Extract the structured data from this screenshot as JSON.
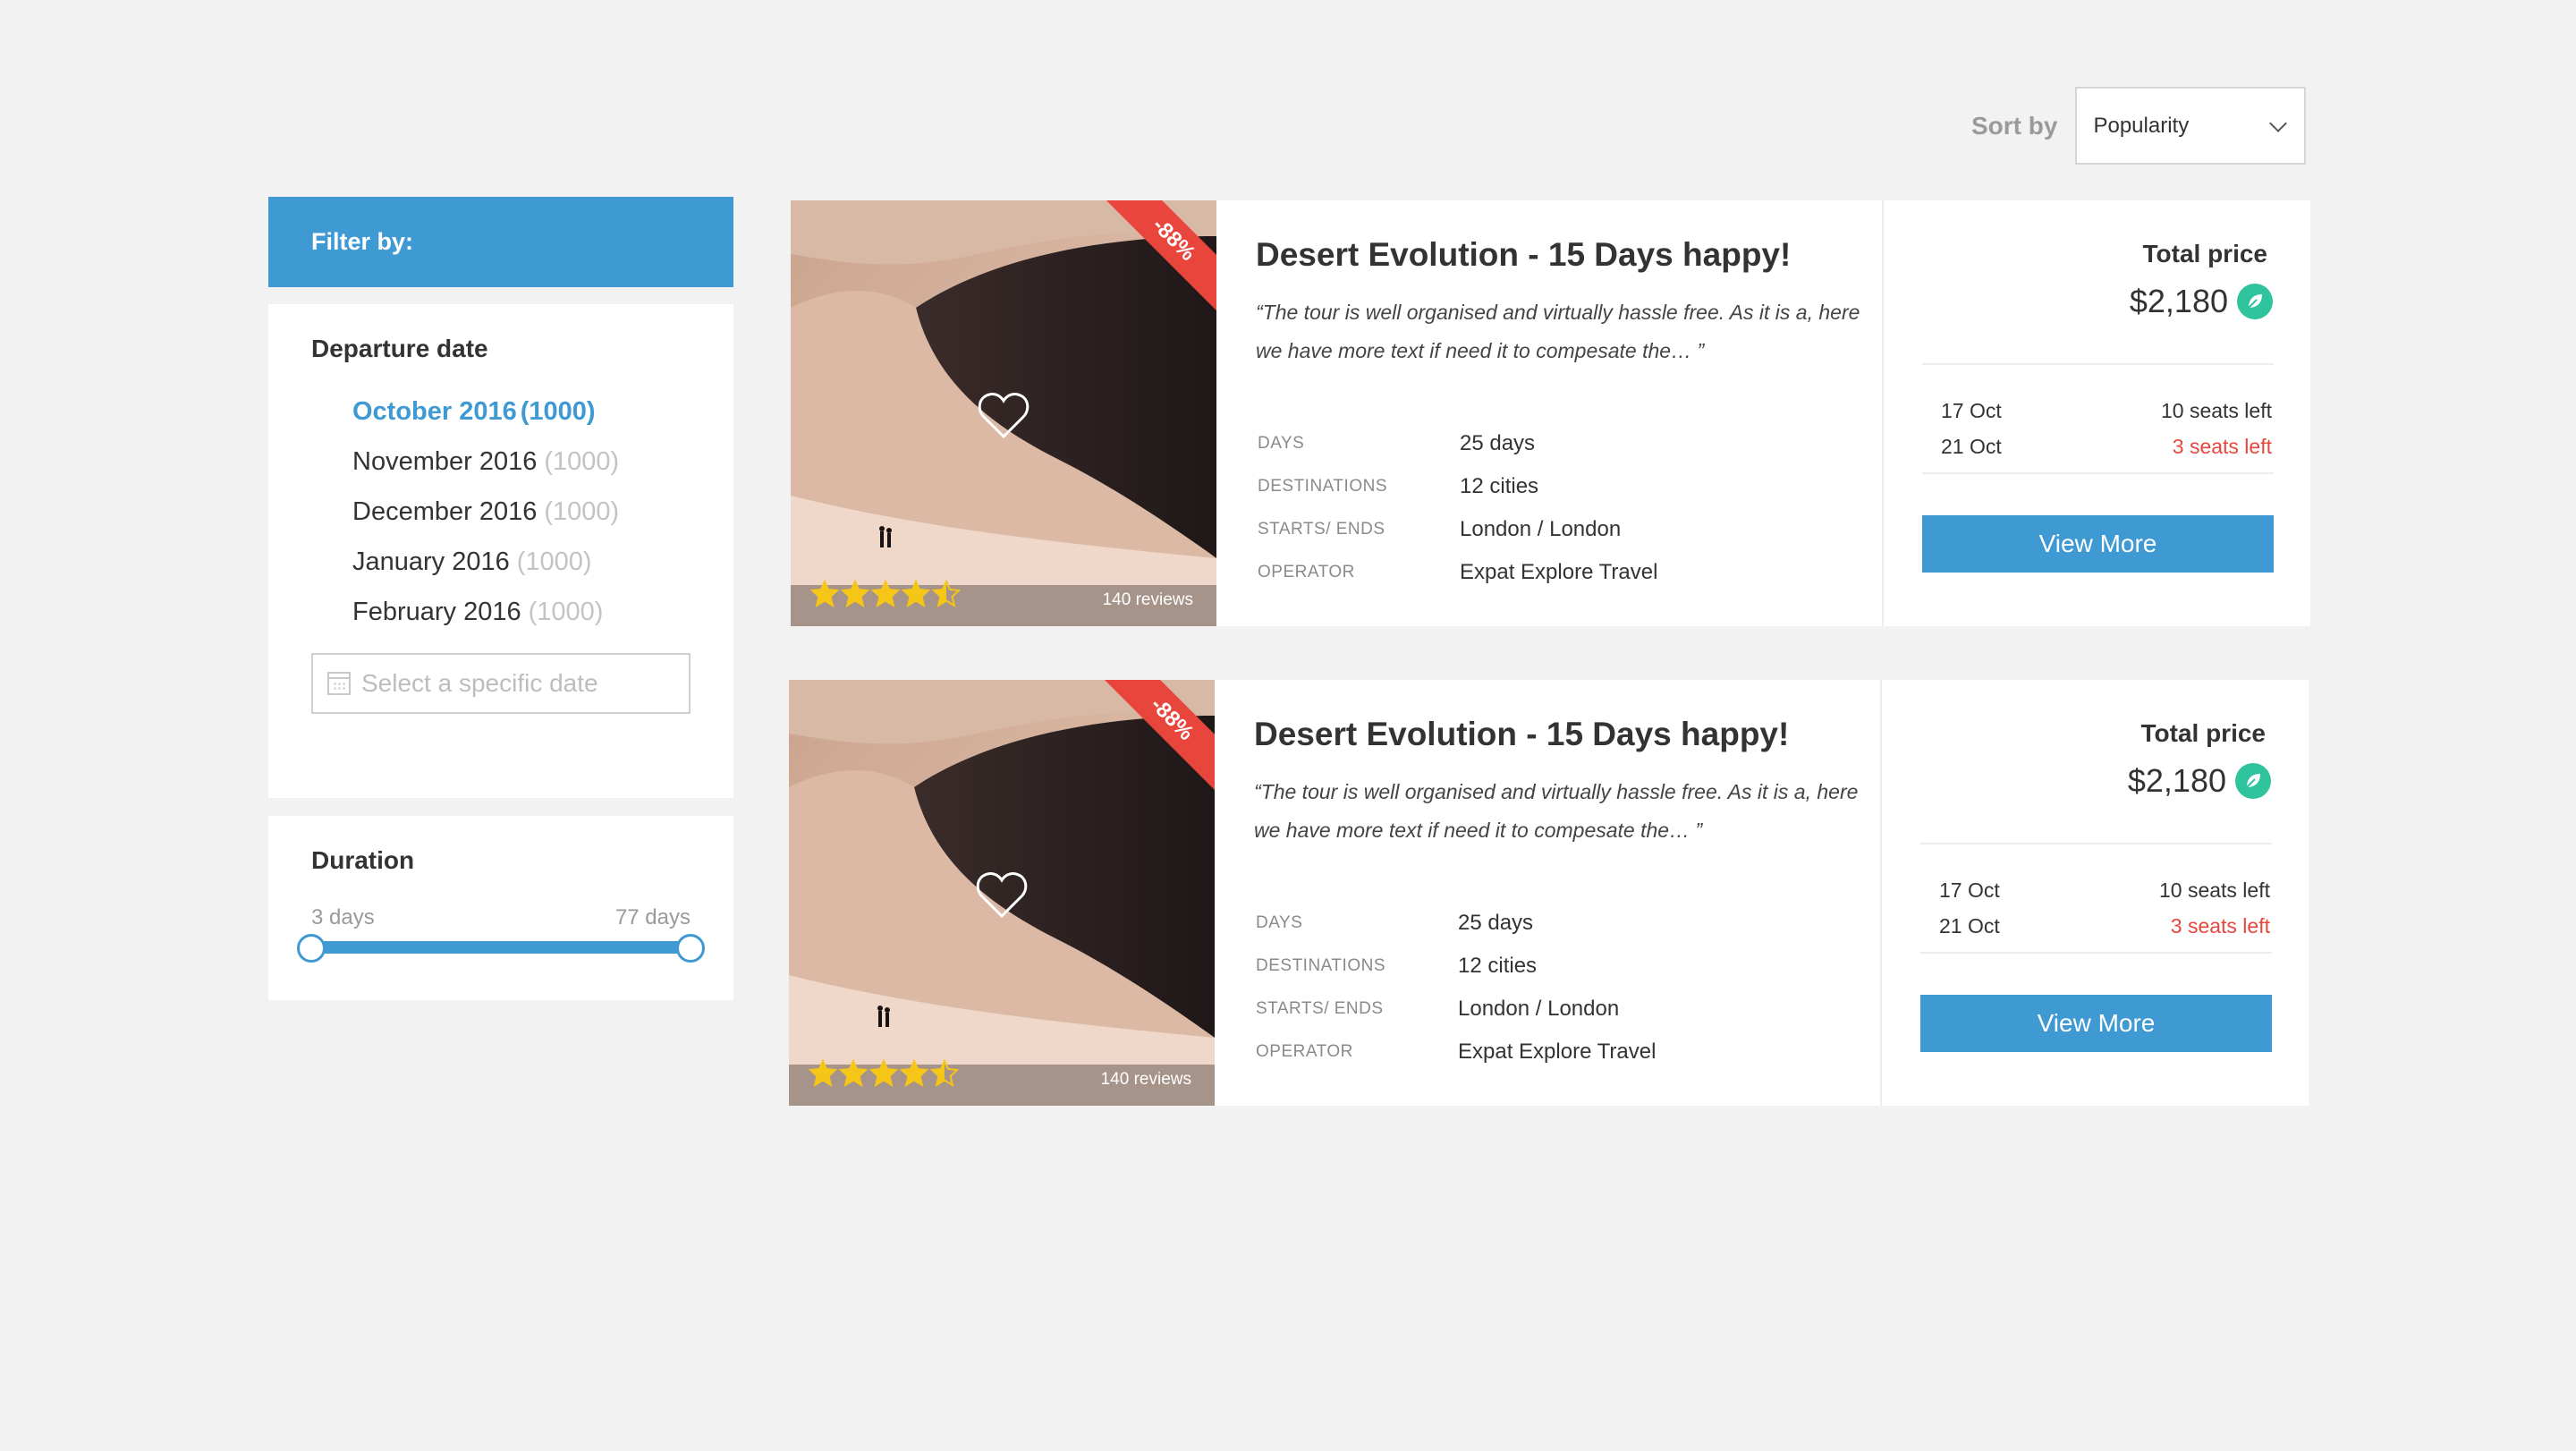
{
  "sort": {
    "label": "Sort by",
    "selected": "Popularity"
  },
  "sidebar": {
    "filter_title": "Filter by:",
    "departure": {
      "title": "Departure date",
      "months": [
        {
          "label": "October 2016",
          "count": "(1000)",
          "active": true
        },
        {
          "label": "November 2016",
          "count": "(1000)",
          "active": false
        },
        {
          "label": "December 2016",
          "count": "(1000)",
          "active": false
        },
        {
          "label": "January 2016",
          "count": "(1000)",
          "active": false
        },
        {
          "label": "February 2016",
          "count": "(1000)",
          "active": false
        }
      ],
      "date_placeholder": "Select a specific date"
    },
    "duration": {
      "title": "Duration",
      "min_label": "3 days",
      "max_label": "77 days",
      "min": 3,
      "max": 77
    }
  },
  "tours": [
    {
      "discount": "-88%",
      "rating": 4.5,
      "reviews": "140 reviews",
      "title": "Desert Evolution - 15 Days happy!",
      "quote": "“The tour is well organised and virtually hassle free. As it is a, here we have more text if need it to compesate the… ”",
      "info": [
        {
          "key": "DAYS",
          "value": "25 days"
        },
        {
          "key": "DESTINATIONS",
          "value": "12 cities"
        },
        {
          "key": "STARTS/ ENDS",
          "value": "London / London"
        },
        {
          "key": "OPERATOR",
          "value": "Expat Explore Travel"
        }
      ],
      "price_label": "Total price",
      "price": "$2,180",
      "departures": [
        {
          "date": "17 Oct",
          "seats": "10 seats left",
          "low": false
        },
        {
          "date": "21 Oct",
          "seats": "3 seats left",
          "low": true
        }
      ],
      "button": "View More"
    },
    {
      "discount": "-88%",
      "rating": 4.5,
      "reviews": "140 reviews",
      "title": "Desert Evolution - 15 Days happy!",
      "quote": "“The tour is well organised and virtually hassle free. As it is a, here we have more text if need it to compesate the… ”",
      "info": [
        {
          "key": "DAYS",
          "value": "25 days"
        },
        {
          "key": "DESTINATIONS",
          "value": "12 cities"
        },
        {
          "key": "STARTS/ ENDS",
          "value": "London / London"
        },
        {
          "key": "OPERATOR",
          "value": "Expat Explore Travel"
        }
      ],
      "price_label": "Total price",
      "price": "$2,180",
      "departures": [
        {
          "date": "17 Oct",
          "seats": "10 seats left",
          "low": false
        },
        {
          "date": "21 Oct",
          "seats": "3 seats left",
          "low": true
        }
      ],
      "button": "View More"
    }
  ],
  "colors": {
    "accent": "#3f9ad3",
    "discount": "#e8463c",
    "leaf": "#2fc39e",
    "star": "#f5c518"
  }
}
